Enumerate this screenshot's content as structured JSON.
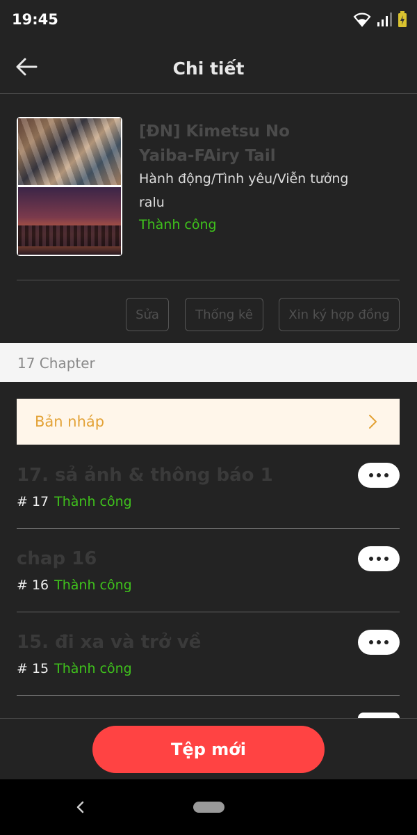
{
  "status_bar": {
    "time": "19:45"
  },
  "app_bar": {
    "title": "Chi tiết"
  },
  "novel": {
    "title": "[ĐN] Kimetsu No Yaiba-FAiry Tail",
    "genres": "Hành động/Tình yêu/Viễn tưởng",
    "author": "ralu",
    "status": "Thành công"
  },
  "actions": {
    "edit": "Sửa",
    "stats": "Thống kê",
    "contract": "Xin ký hợp đồng"
  },
  "chapter_count": "17 Chapter",
  "draft": {
    "label": "Bản nháp"
  },
  "chapters": [
    {
      "title": "17. sả ảnh & thông báo 1",
      "number": "# 17",
      "status": "Thành công"
    },
    {
      "title": "chap 16",
      "number": "# 16",
      "status": "Thành công"
    },
    {
      "title": "15. đi xa và trở về",
      "number": "# 15",
      "status": "Thành công"
    }
  ],
  "bottom": {
    "new_file": "Tệp mới"
  },
  "colors": {
    "success": "#3fc21c",
    "primary_button": "#ff4343",
    "draft_text": "#e3a236"
  }
}
